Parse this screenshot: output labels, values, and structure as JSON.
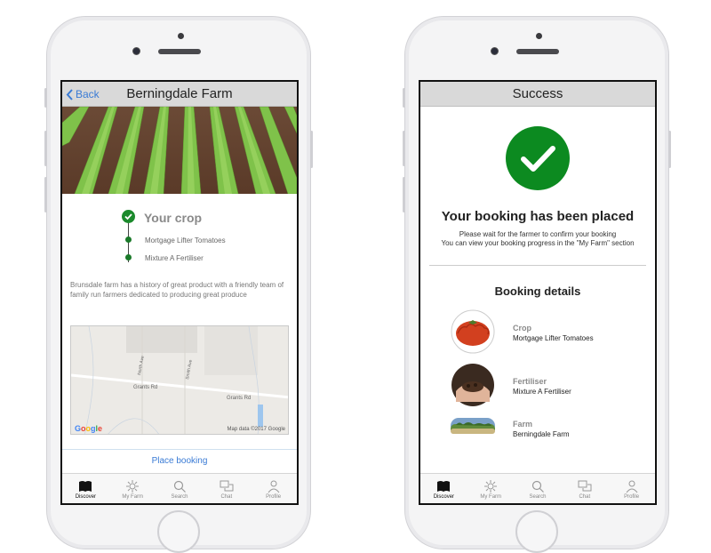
{
  "left_screen": {
    "back_label": "Back",
    "title": "Berningdale Farm",
    "crop": {
      "title": "Your crop",
      "items": [
        "Mortgage Lifter Tomatoes",
        "Mixture A Fertiliser"
      ]
    },
    "description": "Brunsdale farm has a history of great product with a friendly team of family run farmers dedicated to producing great produce",
    "map": {
      "road_labels": [
        "Grants Rd",
        "Grants Rd",
        "North Ave",
        "Smith Ave"
      ],
      "credit": "Map data ©2017 Google",
      "logo": "Google"
    },
    "place_booking_label": "Place booking"
  },
  "right_screen": {
    "title": "Success",
    "headline": "Your booking has been placed",
    "subtext_1": "Please wait for the farmer to confirm your booking",
    "subtext_2": "You can view your booking progress in the \"My Farm\" section",
    "details_title": "Booking details",
    "details": [
      {
        "label": "Crop",
        "value": "Mortgage Lifter Tomatoes"
      },
      {
        "label": "Fertiliser",
        "value": "Mixture A Fertiliser"
      },
      {
        "label": "Farm",
        "value": "Berningdale Farm"
      }
    ]
  },
  "tabbar": {
    "tabs": [
      {
        "label": "Discover",
        "icon": "book-icon",
        "active": true
      },
      {
        "label": "My Farm",
        "icon": "sunflower-icon",
        "active": false
      },
      {
        "label": "Search",
        "icon": "search-icon",
        "active": false
      },
      {
        "label": "Chat",
        "icon": "chat-icon",
        "active": false
      },
      {
        "label": "Profile",
        "icon": "profile-icon",
        "active": false
      }
    ]
  },
  "colors": {
    "accent_blue": "#3a7bd5",
    "success_green": "#0c8a20",
    "navbar_gray": "#d9d9d9"
  }
}
